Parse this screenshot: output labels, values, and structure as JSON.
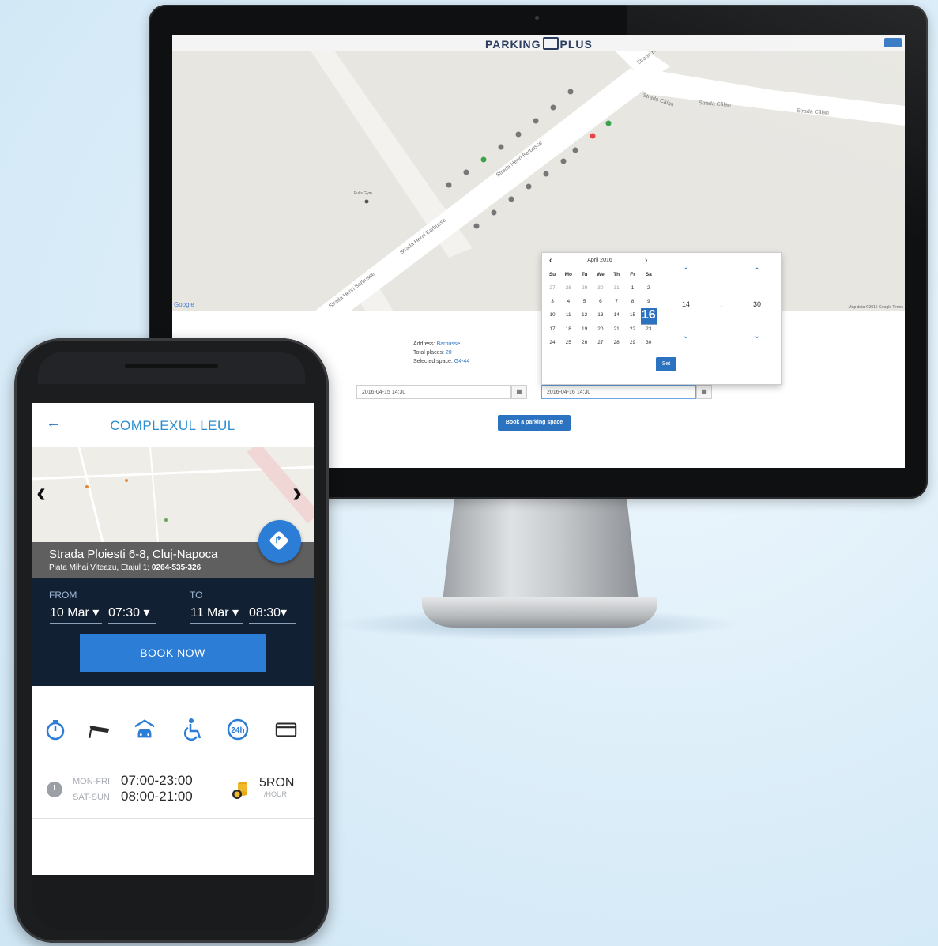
{
  "desktop": {
    "brand": "PARKING",
    "brand_suffix": "PLUS",
    "map": {
      "streets": [
        "Strada Călan",
        "Strada Călan",
        "Strada Călan",
        "Strada Henri Barbusse",
        "Strada Henri Barbusse",
        "Strada Henri Barbusse",
        "Strada Henri Barbusse",
        "Strada H"
      ],
      "poi": "Pulls Gym",
      "footer": "Map data ©2016 Google   Terms",
      "google": "Google"
    },
    "info": {
      "address_label": "Address:",
      "address_value": "Barbusse",
      "total_label": "Total places:",
      "total_value": "20",
      "selected_label": "Selected space:",
      "selected_value": "G4-44"
    },
    "from_value": "2016-04-15 14:30",
    "to_value": "2016-04-16 14:30",
    "book_button": "Book a parking space",
    "picker": {
      "month": "April 2016",
      "weekdays": [
        "Su",
        "Mo",
        "Tu",
        "We",
        "Th",
        "Fr",
        "Sa"
      ],
      "weeks": [
        [
          "27",
          "28",
          "29",
          "30",
          "31",
          "1",
          "2"
        ],
        [
          "3",
          "4",
          "5",
          "6",
          "7",
          "8",
          "9"
        ],
        [
          "10",
          "11",
          "12",
          "13",
          "14",
          "15",
          "16"
        ],
        [
          "17",
          "18",
          "19",
          "20",
          "21",
          "22",
          "23"
        ],
        [
          "24",
          "25",
          "26",
          "27",
          "28",
          "29",
          "30"
        ]
      ],
      "selected_day": "16",
      "hour": "14",
      "minute": "30",
      "separator": ":",
      "set_button": "Set"
    }
  },
  "mobile": {
    "title": "COMPLEXUL LEUL",
    "address_line1": "Strada Ploiesti 6-8, Cluj-Napoca",
    "address_line2": "Piata Mihai Viteazu, Etajul 1;",
    "phone": "0264-535-326",
    "from_label": "FROM",
    "to_label": "TO",
    "from_date": "10 Mar ▾",
    "from_time": "07:30 ▾",
    "to_date": "11 Mar ▾",
    "to_time": "08:30▾",
    "book_now": "BOOK NOW",
    "amenities": [
      "timer-icon",
      "security-camera-icon",
      "covered-parking-icon",
      "wheelchair-icon",
      "24h-icon",
      "card-payment-icon"
    ],
    "badge_24h": "24h",
    "weekday_label": "MON-FRI",
    "weekday_hours": "07:00-23:00",
    "weekend_label": "SAT-SUN",
    "weekend_hours": "08:00-21:00",
    "price": "5RON",
    "price_unit": "/HOUR",
    "accent_color": "#2b7dd6",
    "panel_color": "#122033"
  }
}
